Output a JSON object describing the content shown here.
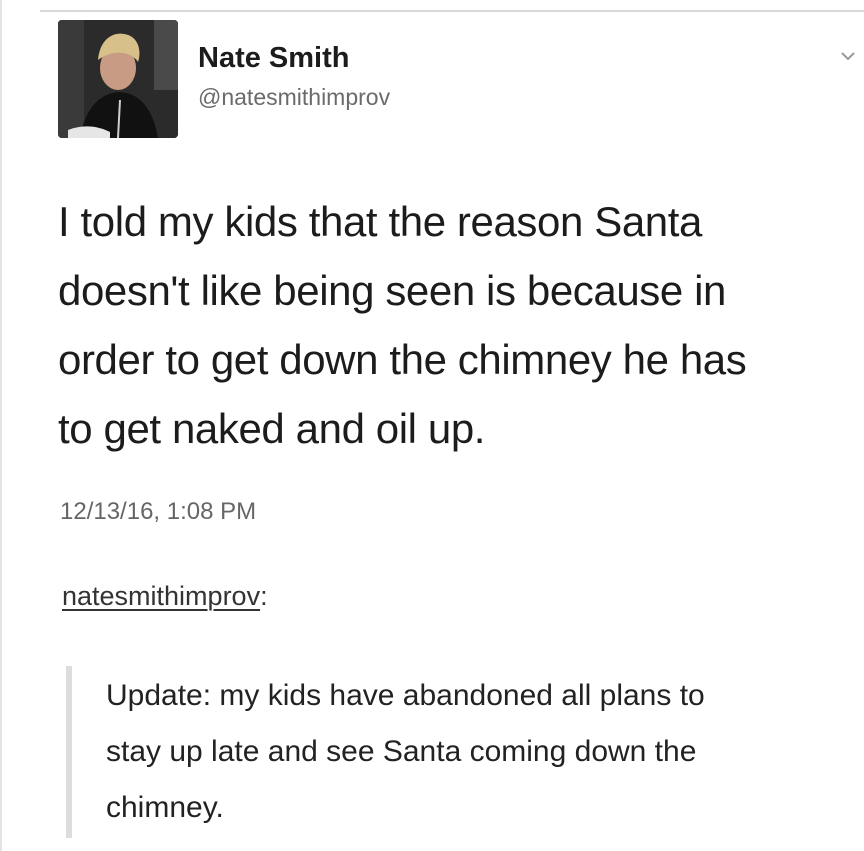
{
  "tweet": {
    "display_name": "Nate Smith",
    "handle": "@natesmithimprov",
    "text_lines": [
      "I told my kids that the reason Santa",
      "doesn't like being seen is because in",
      "order to get down the chimney he has",
      "to get naked and oil up."
    ],
    "timestamp": "12/13/16, 1:08 PM",
    "menu_icon": "chevron-down-icon",
    "avatar_icon": "avatar"
  },
  "reblog": {
    "username": "natesmithimprov",
    "separator": ":",
    "text_lines": [
      "Update: my kids have abandoned all plans to",
      "stay up late and see Santa coming down the",
      "chimney."
    ]
  },
  "colors": {
    "text": "#1c1c1c",
    "muted": "#666666",
    "quote_bar": "#dddddd",
    "background": "#ffffff"
  }
}
